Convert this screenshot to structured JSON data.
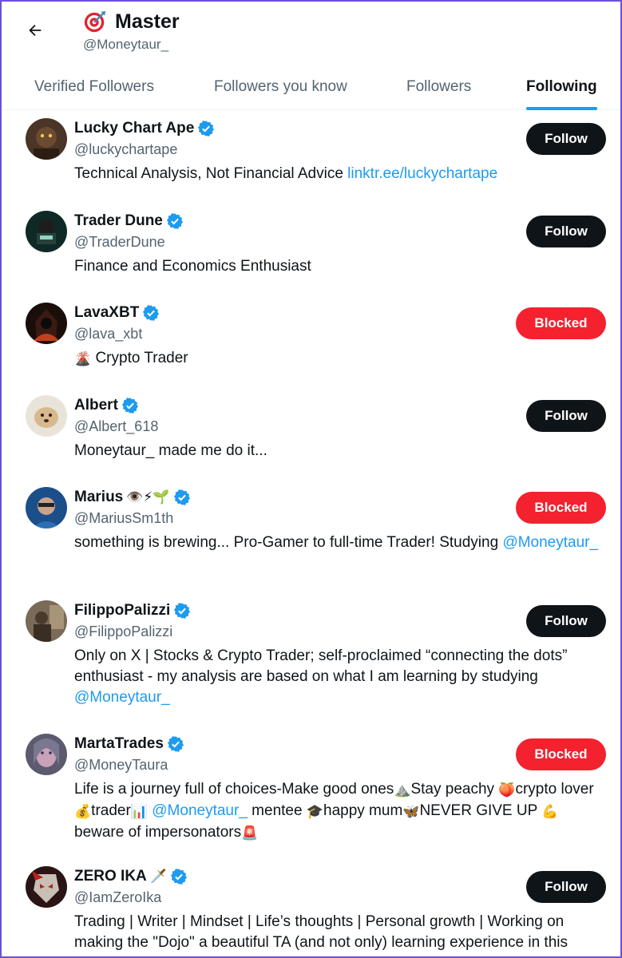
{
  "header": {
    "back_icon": "arrow-left-icon",
    "title_emoji": "target-icon",
    "title": "Master",
    "handle": "@Moneytaur_"
  },
  "tabs": [
    {
      "label": "Verified Followers",
      "active": false
    },
    {
      "label": "Followers you know",
      "active": false
    },
    {
      "label": "Followers",
      "active": false
    },
    {
      "label": "Following",
      "active": true
    }
  ],
  "colors": {
    "accent": "#1d9bf0",
    "follow_button": "#0f1419",
    "blocked_button": "#f4212e",
    "secondary_text": "#536471"
  },
  "users": [
    {
      "name": "Lucky Chart Ape",
      "name_emoji": "",
      "handle": "@luckychartape",
      "button": "Follow",
      "bio_text": "Technical Analysis, Not Financial Advice ",
      "bio_link": "linktr.ee/luckychartape"
    },
    {
      "name": "Trader Dune",
      "name_emoji": "",
      "handle": "@TraderDune",
      "button": "Follow",
      "bio_text": "Finance and Economics Enthusiast"
    },
    {
      "name": "LavaXBT",
      "name_emoji": "",
      "handle": "@lava_xbt",
      "button": "Blocked",
      "bio_emoji": "🌋",
      "bio_text": " Crypto Trader"
    },
    {
      "name": "Albert",
      "name_emoji": "",
      "handle": "@Albert_618",
      "button": "Follow",
      "bio_text": "Moneytaur_ made me do it..."
    },
    {
      "name": "Marius",
      "name_emoji": "👁️⚡🌱",
      "handle": "@MariusSm1th",
      "button": "Blocked",
      "bio_text": "something is brewing... Pro-Gamer to full-time Trader! Studying ",
      "bio_link": "@Moneytaur_"
    },
    {
      "name": "FilippoPalizzi",
      "name_emoji": "",
      "handle": "@FilippoPalizzi",
      "button": "Follow",
      "bio_text": "Only on X | Stocks & Crypto Trader; self-proclaimed “connecting the dots” enthusiast - my analysis are based on what I am learning by studying ",
      "bio_link": "@Moneytaur_"
    },
    {
      "name": "MartaTrades",
      "name_emoji": "",
      "handle": "@MoneyTaura",
      "button": "Blocked",
      "bio_part1": "Life is a journey full of choices-Make good ones",
      "bio_emoji1": "⛰️",
      "bio_part2": "Stay peachy",
      "bio_emoji2": "🍑",
      "bio_part3": "crypto lover",
      "bio_emoji3": "💰",
      "bio_part4": "trader",
      "bio_emoji4": "📊",
      "bio_link": "@Moneytaur_",
      "bio_part5": " mentee ",
      "bio_emoji5": "🎓",
      "bio_part6": "happy mum",
      "bio_emoji6": "🦋",
      "bio_part7": "NEVER GIVE UP ",
      "bio_emoji7": "💪",
      "bio_part8": "beware of impersonators",
      "bio_emoji8": "🚨"
    },
    {
      "name": "ZERO IKA",
      "name_emoji": "🗡️",
      "handle": "@IamZeroIka",
      "button": "Follow",
      "bio_text": "Trading | Writer | Mindset | Life’s thoughts | Personal growth | Working on making the \"Dojo\" a beautiful TA (and not only) learning experience in this"
    }
  ]
}
